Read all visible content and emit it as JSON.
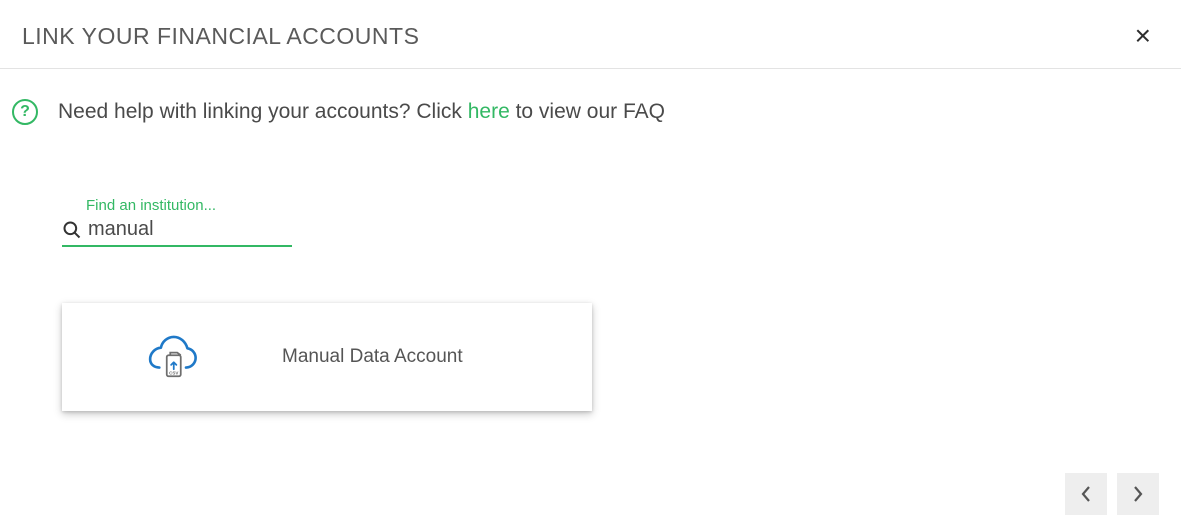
{
  "header": {
    "title": "LINK YOUR FINANCIAL ACCOUNTS"
  },
  "help": {
    "prefix": "Need help with linking your accounts? Click ",
    "link_text": "here",
    "suffix": " to view our FAQ"
  },
  "search": {
    "label": "Find an institution...",
    "value": "manual",
    "placeholder": ""
  },
  "results": [
    {
      "label": "Manual Data Account",
      "icon": "cloud-csv-upload"
    }
  ],
  "icons": {
    "close": "×",
    "help": "?"
  },
  "colors": {
    "accent": "#33b864",
    "text": "#4a4a4a"
  }
}
